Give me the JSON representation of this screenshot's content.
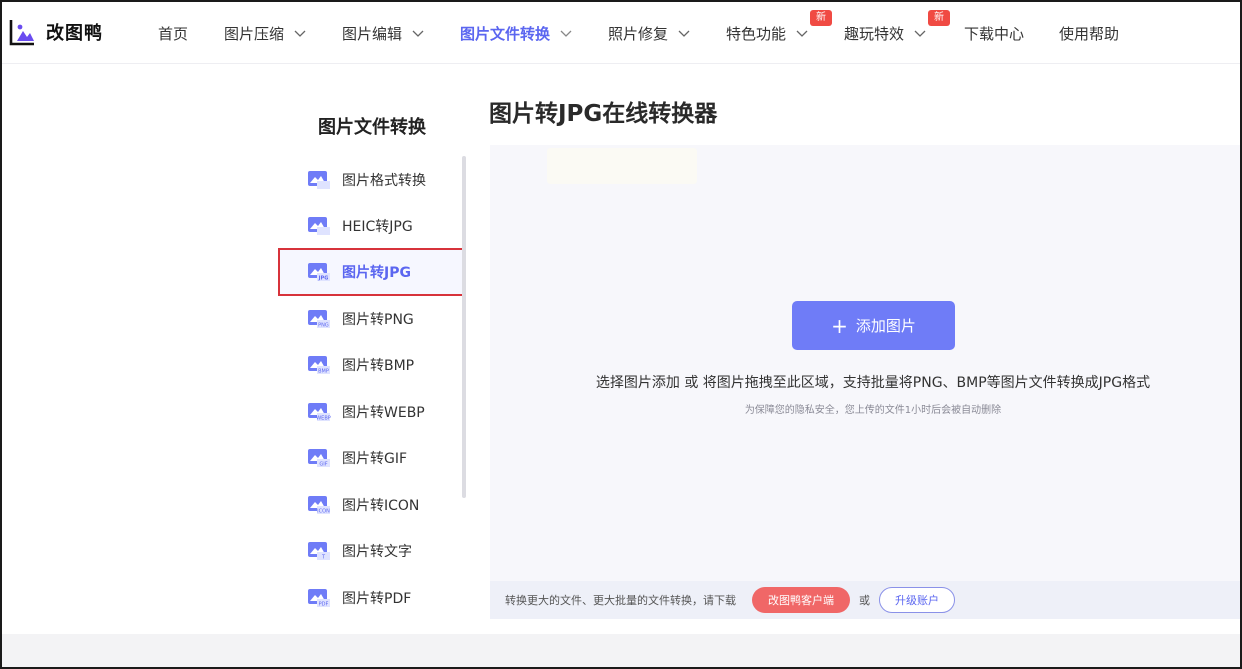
{
  "brand": {
    "name": "改图鸭"
  },
  "nav": [
    {
      "label": "首页",
      "has_dropdown": false
    },
    {
      "label": "图片压缩",
      "has_dropdown": true
    },
    {
      "label": "图片编辑",
      "has_dropdown": true
    },
    {
      "label": "图片文件转换",
      "has_dropdown": true,
      "active": true
    },
    {
      "label": "照片修复",
      "has_dropdown": true
    },
    {
      "label": "特色功能",
      "has_dropdown": true,
      "badge": "新"
    },
    {
      "label": "趣玩特效",
      "has_dropdown": true,
      "badge": "新"
    },
    {
      "label": "下载中心",
      "has_dropdown": false
    },
    {
      "label": "使用帮助",
      "has_dropdown": false
    }
  ],
  "sidebar": {
    "title": "图片文件转换",
    "items": [
      {
        "label": "图片格式转换",
        "icon": "image-convert-icon",
        "tag": ""
      },
      {
        "label": "HEIC转JPG",
        "icon": "heic-jpg-icon",
        "tag": ""
      },
      {
        "label": "图片转JPG",
        "icon": "image-jpg-icon",
        "tag": "JPG",
        "active": true
      },
      {
        "label": "图片转PNG",
        "icon": "image-png-icon",
        "tag": "PNG"
      },
      {
        "label": "图片转BMP",
        "icon": "image-bmp-icon",
        "tag": "BMP"
      },
      {
        "label": "图片转WEBP",
        "icon": "image-webp-icon",
        "tag": "WEBP"
      },
      {
        "label": "图片转GIF",
        "icon": "image-gif-icon",
        "tag": "GIF"
      },
      {
        "label": "图片转ICON",
        "icon": "image-icon-icon",
        "tag": "ICON"
      },
      {
        "label": "图片转文字",
        "icon": "image-text-icon",
        "tag": "T"
      },
      {
        "label": "图片转PDF",
        "icon": "image-pdf-icon",
        "tag": "PDF"
      }
    ]
  },
  "main": {
    "title": "图片转JPG在线转换器",
    "add_button": "添加图片",
    "hint": "选择图片添加 或 将图片拖拽至此区域，支持批量将PNG、BMP等图片文件转换成JPG格式",
    "privacy_note": "为保障您的隐私安全，您上传的文件1小时后会被自动删除"
  },
  "bottom_bar": {
    "text": "转换更大的文件、更大批量的文件转换，请下载",
    "client_button": "改图鸭客户端",
    "or": "或",
    "upgrade_button": "升级账户"
  },
  "colors": {
    "accent": "#5b66f0",
    "button": "#6f7cf7",
    "badge": "#f04a43",
    "highlight_border": "#d7333b"
  }
}
